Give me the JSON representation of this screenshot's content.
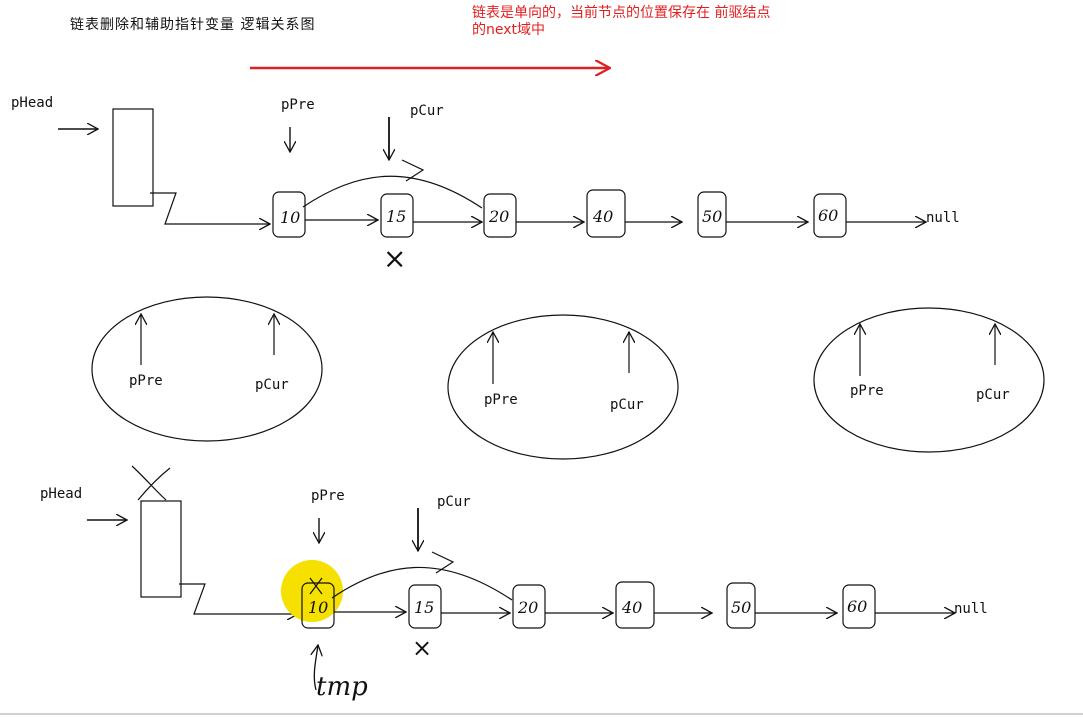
{
  "title": "链表删除和辅助指针变量 逻辑关系图",
  "note": "链表是单向的，当前节点的位置保存在 前驱结点的next域中",
  "colors": {
    "note": "#e02020",
    "arrow_red": "#e02020",
    "highlight": "#f5e000",
    "ink": "#111111"
  },
  "pointers": {
    "head": "pHead",
    "pre": "pPre",
    "cur": "pCur",
    "tmp": "tmp"
  },
  "node_values": [
    "10",
    "15",
    "20",
    "40",
    "50",
    "60"
  ],
  "tail": "null",
  "removed_mark": "×",
  "ellipses": [
    {
      "left": "pPre",
      "right": "pCur"
    },
    {
      "left": "pPre",
      "right": "pCur"
    },
    {
      "left": "pPre",
      "right": "pCur"
    }
  ]
}
